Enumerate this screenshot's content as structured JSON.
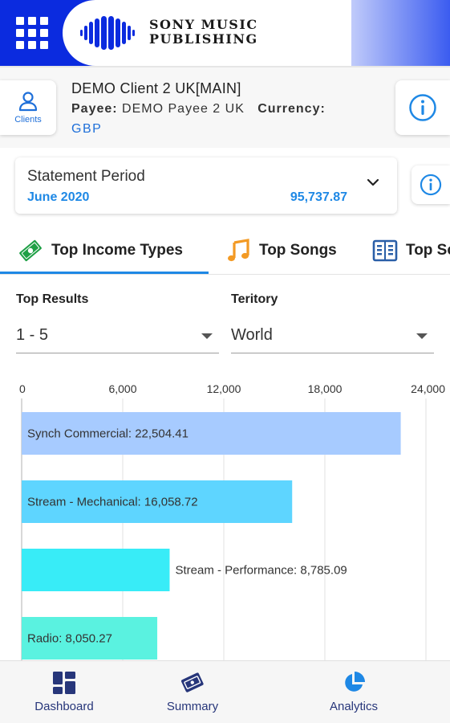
{
  "header": {
    "brand_line1": "SONY MUSIC",
    "brand_line2": "PUBLISHING",
    "menu_icon": "grid-menu-icon",
    "logo_icon": "sony-music-logo-icon"
  },
  "client": {
    "clients_button_label": "Clients",
    "name": "DEMO Client 2 UK[MAIN]",
    "payee_label": "Payee:",
    "payee_value": "DEMO Payee 2 UK",
    "currency_label": "Currency:",
    "currency_value": "GBP"
  },
  "statement": {
    "title": "Statement Period",
    "period": "June 2020",
    "amount": "95,737.87"
  },
  "tabs": [
    {
      "label": "Top Income Types",
      "icon": "money-icon",
      "active": true
    },
    {
      "label": "Top Songs",
      "icon": "music-note-icon",
      "active": false
    },
    {
      "label": "Top So",
      "icon": "table-icon",
      "active": false
    }
  ],
  "filters": {
    "results_label": "Top Results",
    "results_value": "1 - 5",
    "territory_label": "Teritory",
    "territory_value": "World"
  },
  "chart_data": {
    "type": "bar",
    "orientation": "horizontal",
    "categories": [
      "Synch Commercial",
      "Stream - Mechanical",
      "Stream - Performance",
      "Radio"
    ],
    "values": [
      22504.41,
      16058.72,
      8785.09,
      8050.27
    ],
    "value_labels": [
      "22,504.41",
      "16,058.72",
      "8,785.09",
      "8,050.27"
    ],
    "ticks": [
      "0",
      "6,000",
      "12,000",
      "18,000",
      "24,000"
    ],
    "xlim": [
      0,
      24000
    ],
    "grid": true,
    "colors": [
      "#a7cbff",
      "#5ed5ff",
      "#38ecf7",
      "#5af2e0"
    ]
  },
  "nav": {
    "dashboard": "Dashboard",
    "summary": "Summary",
    "analytics": "Analytics"
  },
  "colors": {
    "brand_blue": "#0b2bdf",
    "accent": "#1e88e5",
    "nav_text": "#27367a"
  }
}
